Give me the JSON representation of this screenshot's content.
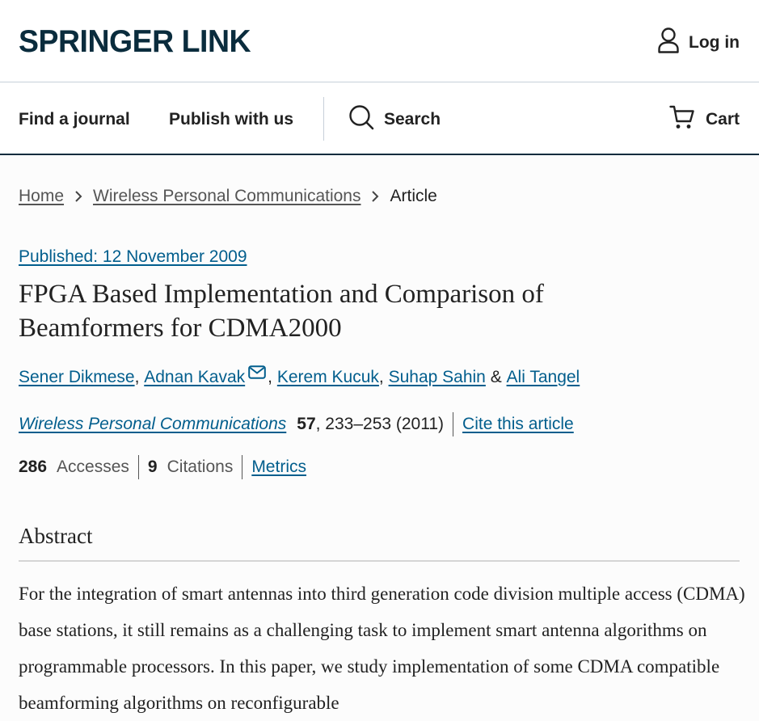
{
  "header": {
    "logo": "SPRINGER LINK",
    "login_label": "Log in"
  },
  "nav": {
    "find_journal": "Find a journal",
    "publish": "Publish with us",
    "search": "Search",
    "cart": "Cart"
  },
  "breadcrumb": {
    "home": "Home",
    "journal": "Wireless Personal Communications",
    "current": "Article"
  },
  "article": {
    "published": "Published: 12 November 2009",
    "title": "FPGA Based Implementation and Comparison of Beamformers for CDMA2000",
    "authors": [
      {
        "name": "Sener Dikmese",
        "sep": ", "
      },
      {
        "name": "Adnan Kavak",
        "sep": ", "
      },
      {
        "name": "Kerem Kucuk",
        "sep": ", "
      },
      {
        "name": "Suhap Sahin",
        "sep": " & "
      },
      {
        "name": "Ali Tangel",
        "sep": ""
      }
    ],
    "journal": "Wireless Personal Communications",
    "volume": "57",
    "pages_year": ", 233–253 (2011)",
    "cite": "Cite this article",
    "accesses_count": "286",
    "accesses_label": "Accesses",
    "citations_count": "9",
    "citations_label": "Citations",
    "metrics": "Metrics"
  },
  "abstract": {
    "heading": "Abstract",
    "text": "For the integration of smart antennas into third generation code division multiple access (CDMA) base stations, it still remains as a challenging task to implement smart antenna algorithms on programmable processors. In this paper, we study implementation of some CDMA compatible beamforming algorithms on reconfigurable"
  },
  "colors": {
    "brand": "#0a2c3d",
    "link": "#025e8d",
    "text": "#222222"
  }
}
